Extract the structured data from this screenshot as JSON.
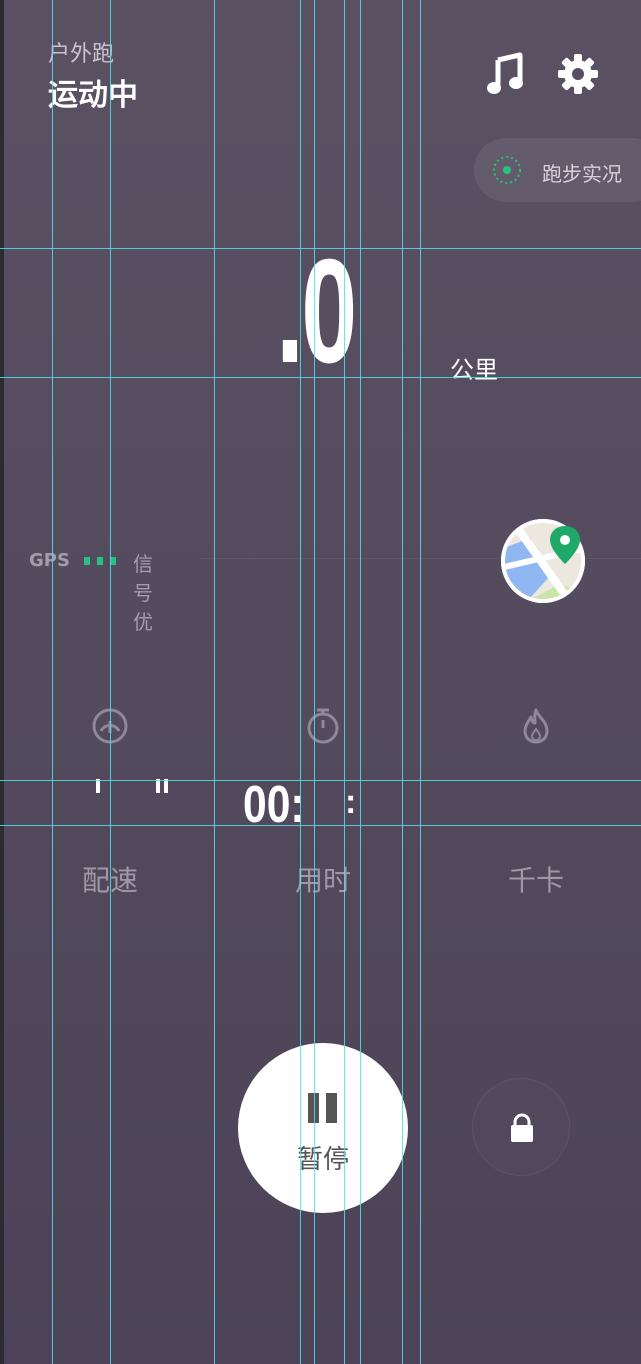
{
  "header": {
    "activity_type": "户外跑",
    "status": "运动中",
    "music_icon": "music-note-icon",
    "settings_icon": "gear-icon"
  },
  "live": {
    "label": "跑步实况",
    "icon": "live-ring-icon"
  },
  "distance": {
    "value": ".0",
    "unit": "公里"
  },
  "gps": {
    "label": "GPS",
    "status": "信号优",
    "signal_bars": 3,
    "bar_color": "#26c281"
  },
  "map": {
    "icon": "map-pin-icon"
  },
  "metrics": {
    "pace": {
      "label": "配速",
      "icon": "speedometer-icon"
    },
    "time": {
      "label": "用时",
      "prefix": "00:",
      "suffix": ":",
      "icon": "stopwatch-icon"
    },
    "calories": {
      "label": "千卡",
      "icon": "flame-icon"
    }
  },
  "controls": {
    "pause_label": "暂停",
    "pause_icon": "pause-icon",
    "lock_icon": "lock-icon"
  },
  "colors": {
    "accent": "#26c281",
    "background": "#574e62",
    "guide": "#4fe3ea"
  }
}
